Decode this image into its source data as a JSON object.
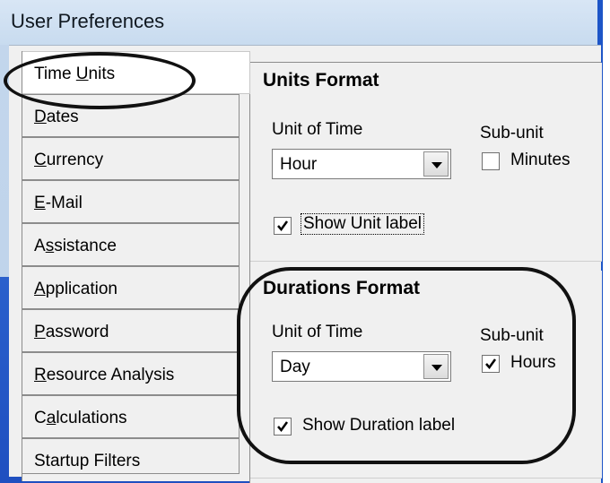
{
  "window": {
    "title": "User Preferences"
  },
  "tabs": [
    {
      "label": "Time Units",
      "u_pre": "Time ",
      "u_char": "U",
      "u_post": "nits"
    },
    {
      "label": "Dates",
      "u_pre": "",
      "u_char": "D",
      "u_post": "ates"
    },
    {
      "label": "Currency",
      "u_pre": "",
      "u_char": "C",
      "u_post": "urrency"
    },
    {
      "label": "E-Mail",
      "u_pre": "",
      "u_char": "E",
      "u_post": "-Mail"
    },
    {
      "label": "Assistance",
      "u_pre": "A",
      "u_char": "s",
      "u_post": "sistance"
    },
    {
      "label": "Application",
      "u_pre": "",
      "u_char": "A",
      "u_post": "pplication"
    },
    {
      "label": "Password",
      "u_pre": "",
      "u_char": "P",
      "u_post": "assword"
    },
    {
      "label": "Resource Analysis",
      "u_pre": "",
      "u_char": "R",
      "u_post": "esource Analysis"
    },
    {
      "label": "Calculations",
      "u_pre": "C",
      "u_char": "a",
      "u_post": "lculations"
    },
    {
      "label": "Startup Filters",
      "u_pre": "",
      "u_char": "",
      "u_post": "Startup Filters"
    }
  ],
  "units_format": {
    "title": "Units Format",
    "unit_of_time_label": "Unit of Time",
    "unit_of_time_value": "Hour",
    "subunit_label": "Sub-unit",
    "subunit_option": "Minutes",
    "subunit_checked": false,
    "show_label": "Show Unit label",
    "show_label_checked": true
  },
  "durations_format": {
    "title": "Durations Format",
    "unit_of_time_label": "Unit of Time",
    "unit_of_time_value": "Day",
    "subunit_label": "Sub-unit",
    "subunit_option": "Hours",
    "subunit_checked": true,
    "show_label": "Show Duration label",
    "show_label_checked": true
  },
  "colors": {
    "window_frame": "#1d55c7",
    "title_bar": "#c8dbef",
    "dialog_bg": "#f0f0f0",
    "annotation": "#111111"
  }
}
